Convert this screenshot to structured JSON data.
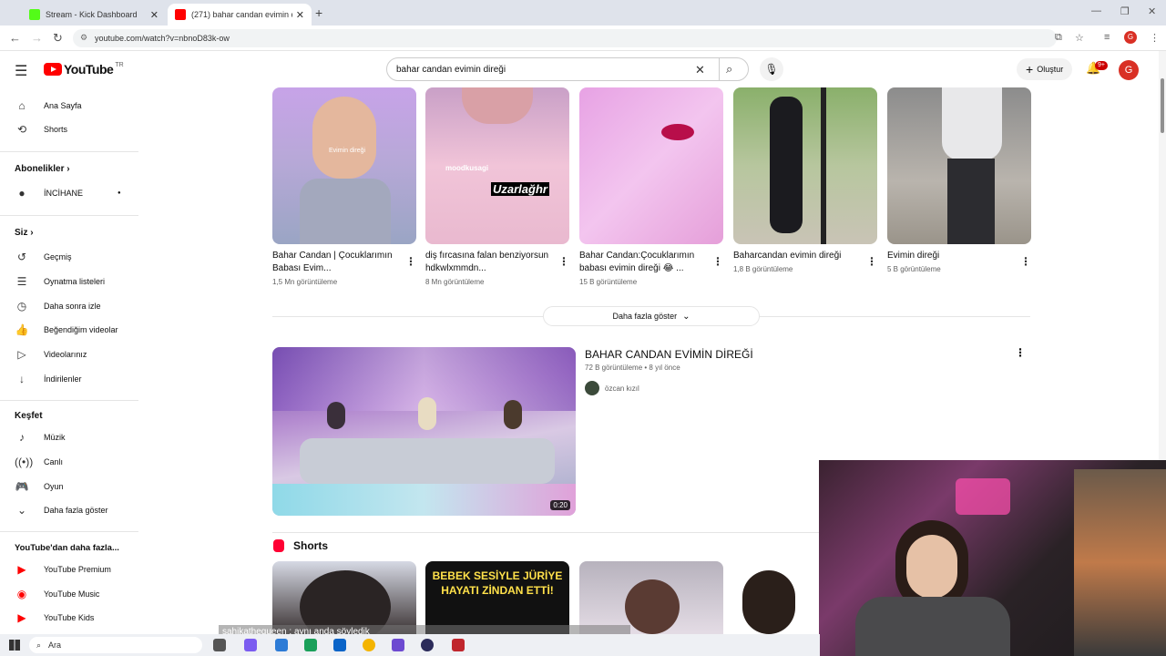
{
  "browser": {
    "tabs": [
      {
        "title": "Stream - Kick Dashboard",
        "close": "✕"
      },
      {
        "title": "(271) bahar candan evimin direğ",
        "close": "✕"
      }
    ],
    "new_tab": "+",
    "url": "youtube.com/watch?v=nbnoD83k-ow"
  },
  "header": {
    "logo_word": "YouTube",
    "logo_country": "TR",
    "search_value": "bahar candan evimin direği",
    "create_label": "Oluştur",
    "notif_badge": "9+",
    "avatar_letter": "G",
    "profile_letter": "G"
  },
  "sidebar": {
    "top": [
      {
        "label": "Ana Sayfa",
        "icon": "home-icon"
      },
      {
        "label": "Shorts",
        "icon": "shorts-icon"
      }
    ],
    "subs_title": "Abonelikler",
    "subs": [
      {
        "label": "İNCİHANE",
        "icon": "channel-avatar"
      }
    ],
    "you_title": "Siz",
    "you": [
      {
        "label": "Geçmiş",
        "icon": "history-icon"
      },
      {
        "label": "Oynatma listeleri",
        "icon": "playlist-icon"
      },
      {
        "label": "Daha sonra izle",
        "icon": "clock-icon"
      },
      {
        "label": "Beğendiğim videolar",
        "icon": "like-icon"
      },
      {
        "label": "Videolarınız",
        "icon": "video-icon"
      },
      {
        "label": "İndirilenler",
        "icon": "download-icon"
      }
    ],
    "explore_title": "Keşfet",
    "explore": [
      {
        "label": "Müzik",
        "icon": "music-icon"
      },
      {
        "label": "Canlı",
        "icon": "live-icon"
      },
      {
        "label": "Oyun",
        "icon": "game-icon"
      },
      {
        "label": "Daha fazla göster",
        "icon": "chevron-down-icon"
      }
    ],
    "more_title": "YouTube'dan daha fazla...",
    "more": [
      {
        "label": "YouTube Premium",
        "icon": "youtube-premium-icon"
      },
      {
        "label": "YouTube Music",
        "icon": "youtube-music-icon"
      },
      {
        "label": "YouTube Kids",
        "icon": "youtube-kids-icon"
      }
    ]
  },
  "shorts_row": [
    {
      "title": "Bahar Candan | Çocuklarımın Babası Evim...",
      "views": "1,5 Mn görüntüleme",
      "overlay": "Evimin direği"
    },
    {
      "title": "diş fırcasına falan benziyorsun hdkwlxmmdn...",
      "views": "8 Mn görüntüleme",
      "overlay": "Uzarlağhr",
      "overlay2": "moodkusagi"
    },
    {
      "title": "Bahar Candan:Çocuklarımın babası evimin direği 😂 ...",
      "views": "15 B görüntüleme"
    },
    {
      "title": "Baharcandan evimin direği",
      "views": "1,8 B görüntüleme"
    },
    {
      "title": "Evimin direği",
      "views": "5 B görüntüleme"
    }
  ],
  "show_more": "Daha fazla göster",
  "video": {
    "title": "BAHAR CANDAN EVİMİN DİREĞİ",
    "meta": "72 B görüntüleme • 8 yıl önce",
    "channel": "özcan kızıl",
    "duration": "0:20"
  },
  "shorts_section": {
    "title": "Shorts",
    "second_text": "BEBEK SESİYLE JÜRİYE HAYATI ZİNDAN ETTİ!"
  },
  "chat_message": "sahikathequeen : aynı anda söyledik",
  "taskbar": {
    "search": "Ara"
  }
}
